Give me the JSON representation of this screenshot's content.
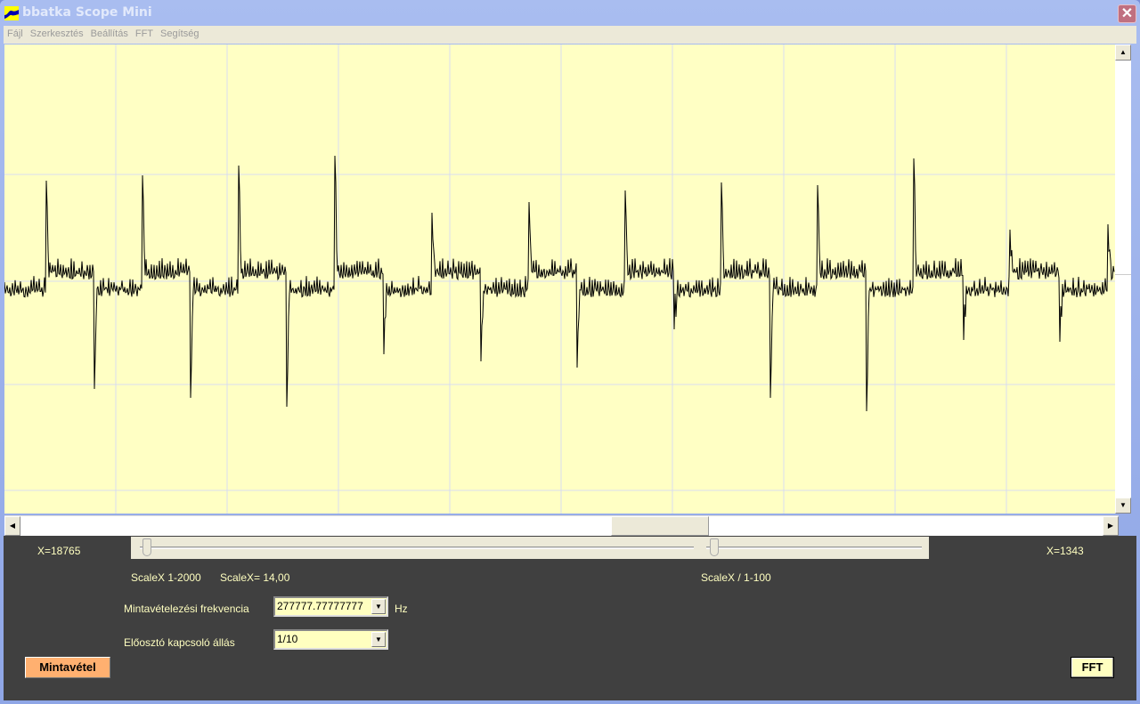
{
  "window": {
    "title": "bbatka Scope Mini",
    "close_icon": "close-icon"
  },
  "menu": {
    "items": [
      {
        "label": "Fájl"
      },
      {
        "label": "Szerkesztés"
      },
      {
        "label": "Beállítás"
      },
      {
        "label": "FFT"
      },
      {
        "label": "Segítség"
      }
    ]
  },
  "plot": {
    "background": "#ffffc4",
    "grid_color": "#d8dcf0",
    "trace_color": "#000000",
    "grid": true
  },
  "controls": {
    "x_left": "X=18765",
    "x_right": "X=1343",
    "scale_range": "ScaleX 1-2000",
    "scale_value": "ScaleX= 14,00",
    "scale_div_range": "ScaleX / 1-100",
    "freq_label": "Mintavételezési frekvencia",
    "freq_value": "277777.77777777",
    "freq_unit": "Hz",
    "prescaler_label": "Előosztó kapcsoló állás",
    "prescaler_value": "1/10",
    "sample_button": "Mintavétel",
    "fft_button": "FFT"
  }
}
